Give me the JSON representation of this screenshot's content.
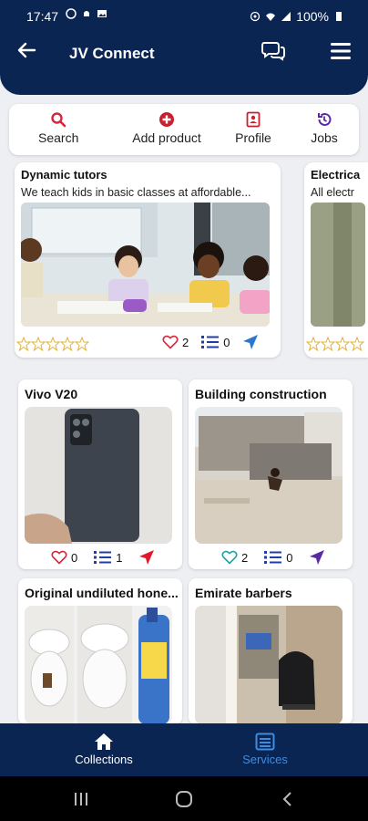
{
  "status_bar": {
    "time": "17:47",
    "battery": "100%"
  },
  "app_bar": {
    "title": "JV Connect"
  },
  "quick_actions": [
    {
      "label": "Search",
      "icon": "search-icon"
    },
    {
      "label": "Add product",
      "icon": "add-circle-icon"
    },
    {
      "label": "Profile",
      "icon": "profile-card-icon"
    },
    {
      "label": "Jobs",
      "icon": "history-icon"
    }
  ],
  "featured": [
    {
      "title": "Dynamic tutors",
      "description": "We teach kids in basic classes at affordable...",
      "likes": "2",
      "comments": "0",
      "rating": 0
    },
    {
      "title": "Electrica",
      "description": "All electr",
      "rating": 0
    }
  ],
  "products": [
    {
      "title": "Vivo V20",
      "likes": "0",
      "comments": "1"
    },
    {
      "title": "Building construction",
      "likes": "2",
      "comments": "0"
    },
    {
      "title": "Original undiluted hone...",
      "likes": "",
      "comments": ""
    },
    {
      "title": "Emirate barbers",
      "likes": "",
      "comments": ""
    }
  ],
  "bottom_nav": [
    {
      "label": "Collections",
      "icon": "home-icon",
      "active": false
    },
    {
      "label": "Services",
      "icon": "list-icon",
      "active": true
    }
  ],
  "colors": {
    "primary": "#0b2553",
    "accent_red": "#d7263d",
    "accent_blue": "#2a78c9",
    "heart": "#d7263d",
    "services_active": "#3c8ce0"
  }
}
